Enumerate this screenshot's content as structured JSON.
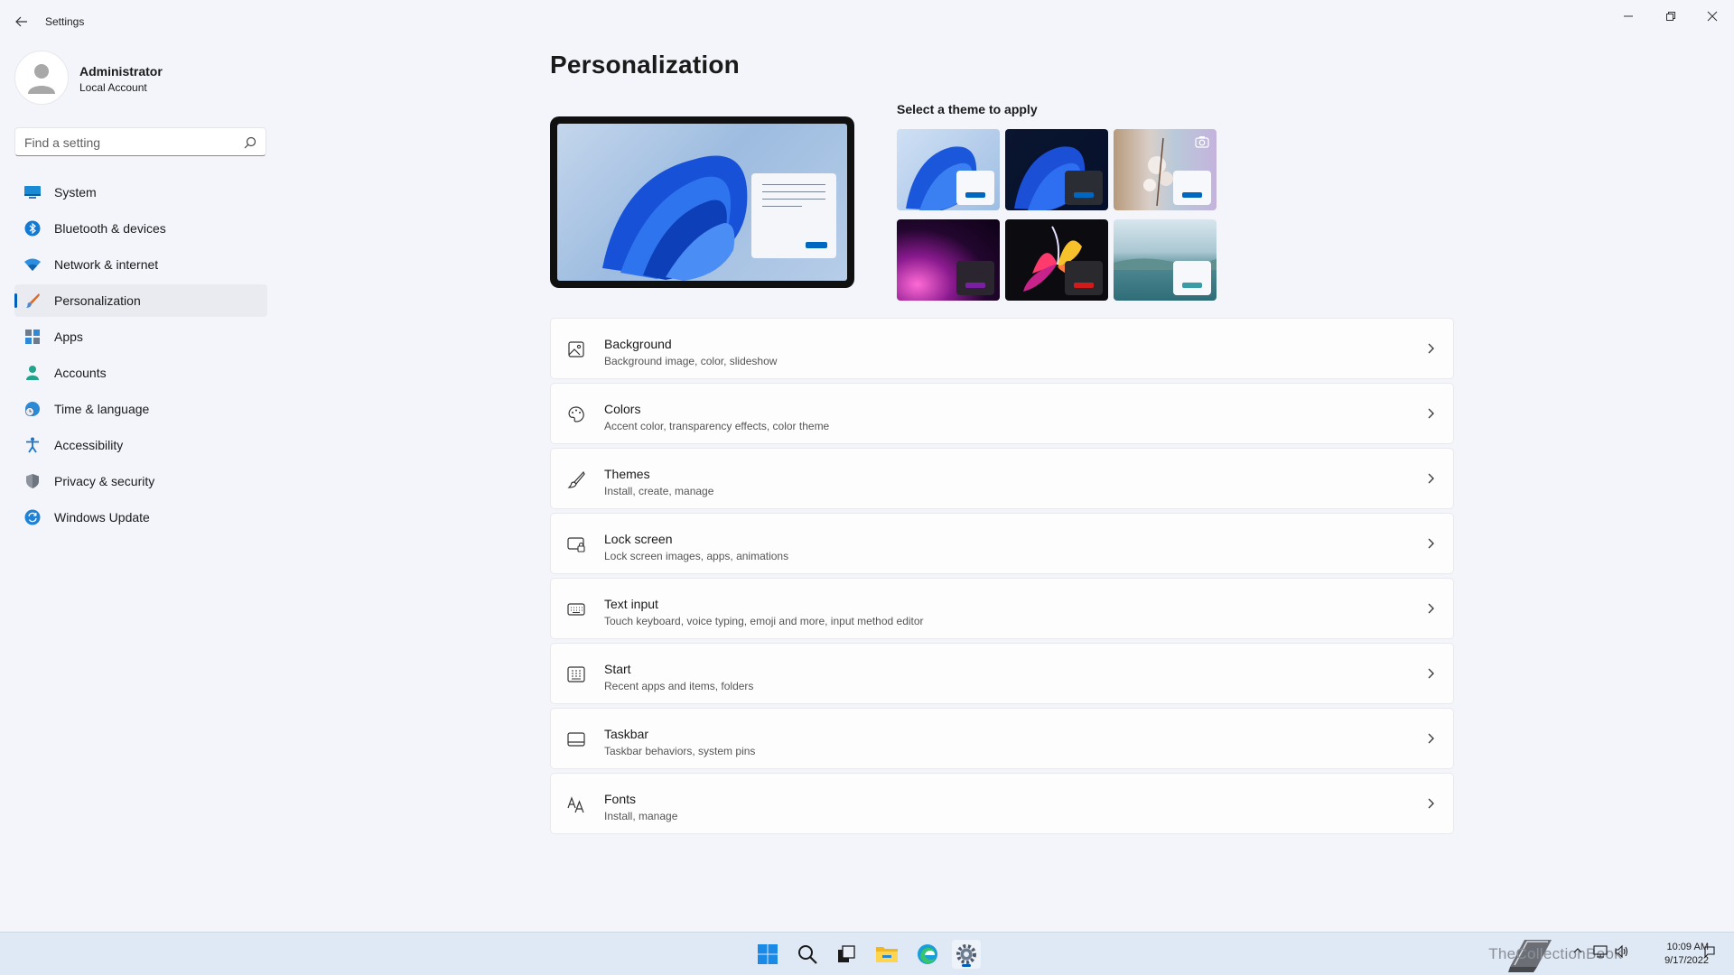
{
  "window": {
    "title": "Settings"
  },
  "profile": {
    "name": "Administrator",
    "account_type": "Local Account"
  },
  "search": {
    "placeholder": "Find a setting"
  },
  "sidebar": {
    "items": [
      {
        "label": "System",
        "icon": "monitor-icon"
      },
      {
        "label": "Bluetooth & devices",
        "icon": "bluetooth-icon"
      },
      {
        "label": "Network & internet",
        "icon": "wifi-icon"
      },
      {
        "label": "Personalization",
        "icon": "brush-icon",
        "active": true
      },
      {
        "label": "Apps",
        "icon": "apps-icon"
      },
      {
        "label": "Accounts",
        "icon": "person-icon"
      },
      {
        "label": "Time & language",
        "icon": "globe-clock-icon"
      },
      {
        "label": "Accessibility",
        "icon": "accessibility-icon"
      },
      {
        "label": "Privacy & security",
        "icon": "shield-icon"
      },
      {
        "label": "Windows Update",
        "icon": "sync-icon"
      }
    ]
  },
  "main": {
    "title": "Personalization",
    "theme_picker_label": "Select a theme to apply",
    "settings": [
      {
        "title": "Background",
        "subtitle": "Background image, color, slideshow",
        "icon": "image-icon"
      },
      {
        "title": "Colors",
        "subtitle": "Accent color, transparency effects, color theme",
        "icon": "palette-icon"
      },
      {
        "title": "Themes",
        "subtitle": "Install, create, manage",
        "icon": "brush-icon"
      },
      {
        "title": "Lock screen",
        "subtitle": "Lock screen images, apps, animations",
        "icon": "lock-screen-icon"
      },
      {
        "title": "Text input",
        "subtitle": "Touch keyboard, voice typing, emoji and more, input method editor",
        "icon": "keyboard-icon"
      },
      {
        "title": "Start",
        "subtitle": "Recent apps and items, folders",
        "icon": "start-menu-icon"
      },
      {
        "title": "Taskbar",
        "subtitle": "Taskbar behaviors, system pins",
        "icon": "taskbar-icon"
      },
      {
        "title": "Fonts",
        "subtitle": "Install, manage",
        "icon": "font-icon"
      }
    ]
  },
  "colors": {
    "accent": "#005fb8",
    "theme_accents": [
      "#0067c0",
      "#0067c0",
      "#0067c0",
      "#7a1fa2",
      "#d11b1b",
      "#3a9ca6"
    ]
  },
  "taskbar": {
    "time": "10:09 AM",
    "date": "9/17/2022",
    "watermark": "TheCollectionBook"
  }
}
